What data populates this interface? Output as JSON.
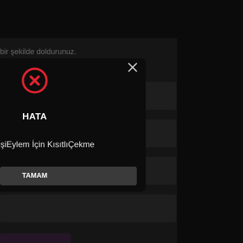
{
  "background_form": {
    "hint_text": "Lütfen formu eksiksiz bir şekilde doldurunuz.",
    "accent_color": "#241626"
  },
  "modal": {
    "title": "HATA",
    "message": "AlışverişiEylem İçin KısıtlıÇekme",
    "ok_label": "TAMAM",
    "icon": "error-circle-x-icon",
    "close_icon": "close-icon",
    "error_color": "#e0232e"
  }
}
